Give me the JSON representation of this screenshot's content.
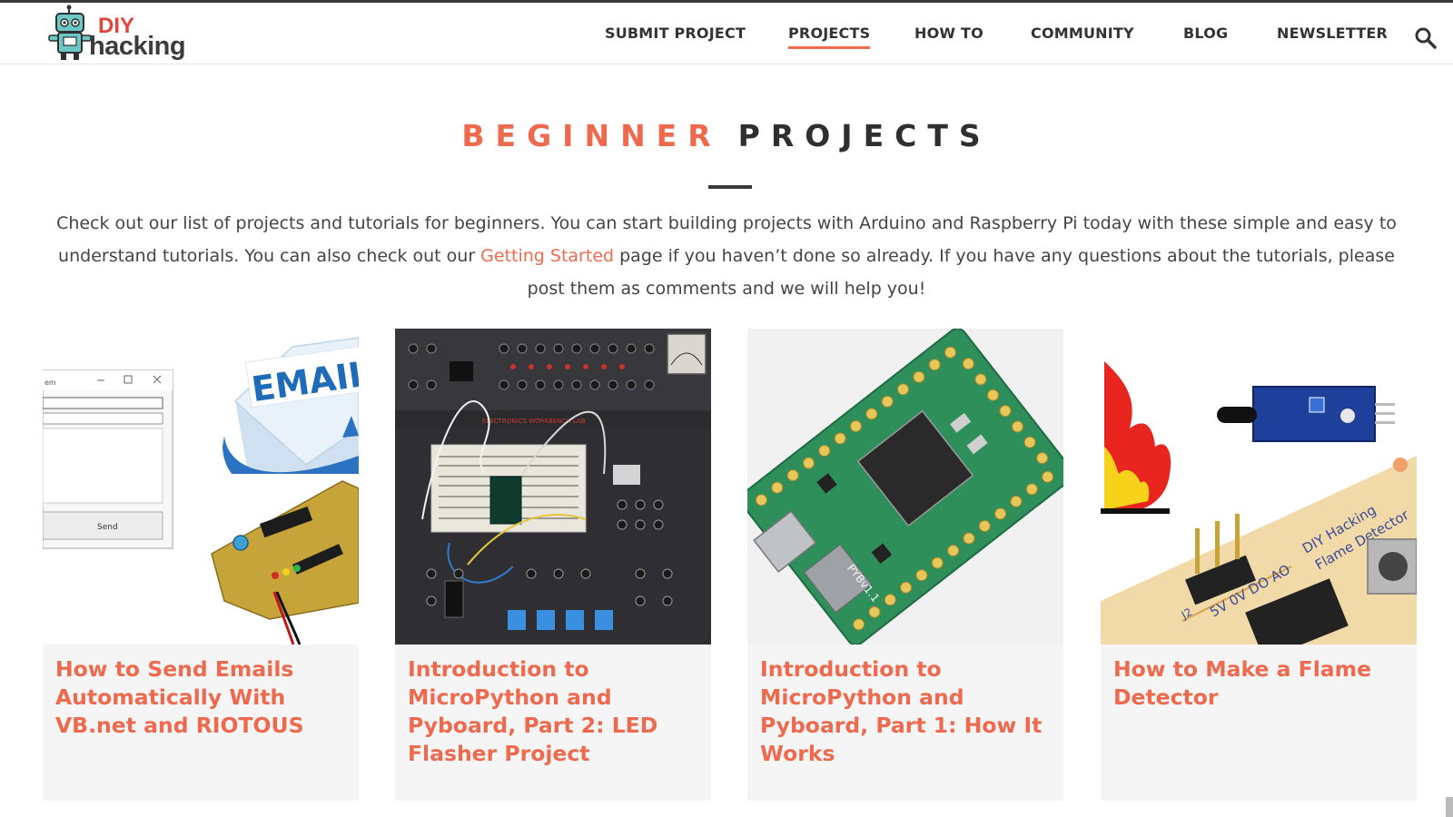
{
  "site": {
    "logo_top": "DIY",
    "logo_bottom": "hacking"
  },
  "nav": {
    "items": [
      {
        "label": "SUBMIT PROJECT",
        "active": false
      },
      {
        "label": "PROJECTS",
        "active": true
      },
      {
        "label": "HOW TO",
        "active": false
      },
      {
        "label": "COMMUNITY",
        "active": false
      },
      {
        "label": "BLOG",
        "active": false
      },
      {
        "label": "NEWSLETTER",
        "active": false
      }
    ],
    "search_icon": "search-icon"
  },
  "page": {
    "title_accent": "BEGINNER",
    "title_main": "PROJECTS",
    "intro_before": "Check out our list of projects and tutorials for beginners. You can start building projects with Arduino and Raspberry Pi today with these simple and easy to understand tutorials. You can also check out our ",
    "intro_link": "Getting Started",
    "intro_after": " page if you haven’t done so already. If you have any questions about the tutorials, please post them as comments and we will help you!"
  },
  "cards": [
    {
      "title": "How to Send Emails Automatically With VB.net and RIOTOUS",
      "image": {
        "envelope_label": "EMAIL",
        "dialog_button": "Send",
        "dialog_title": "em"
      }
    },
    {
      "title": "Introduction to MicroPython and Pyboard, Part 2: LED Flasher Project",
      "image": {
        "panel_label": "ELECTRONICS WORKBENCH LAB"
      }
    },
    {
      "title": "Introduction to MicroPython and Pyboard, Part 1: How It Works",
      "image": {
        "board_label": "PYBv1.1"
      }
    },
    {
      "title": "How to Make a Flame Detector",
      "image": {
        "pcb_text_1": "DIY Hacking",
        "pcb_text_2": "Flame Detector",
        "pin_labels": "5V 0V DO AO",
        "jumper": "J2"
      }
    }
  ],
  "colors": {
    "accent": "#ee6a4e",
    "text": "#444444",
    "dark": "#2f2f2f",
    "card_bg": "#f5f5f5"
  }
}
